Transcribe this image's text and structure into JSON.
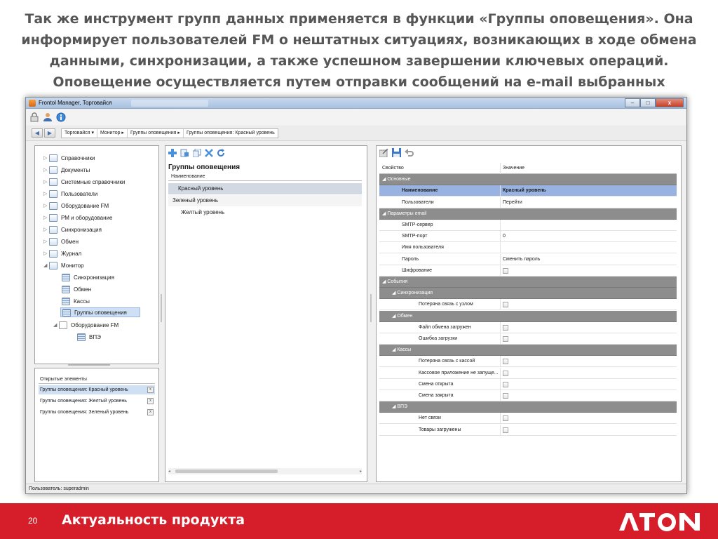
{
  "slide": {
    "heading": "Так же инструмент групп данных применяется в функции «Группы оповещения». Она информирует пользователей FM о нештатных ситуациях, возникающих в ходе обмена данными, синхронизации, а также успешном завершении ключевых операций. Оповещение осуществляется путем отправки сообщений на e-mail выбранных",
    "page_number": "20",
    "footer_title": "Актуальность продукта",
    "logo_text": "ATON",
    "colors": {
      "footer_red": "#d61e2a",
      "heading_gray": "#565656"
    }
  },
  "window": {
    "title": "Frontol Manager, Торговайся",
    "buttons": {
      "minimize": "–",
      "maximize": "□",
      "close": "x"
    },
    "toolbar_icons": [
      "lock-icon",
      "user-icon",
      "info-icon"
    ],
    "status": "Пользователь: superadmin"
  },
  "breadcrumb": {
    "items": [
      "Торговайся ▾",
      "Монитор ▸",
      "Группы оповещения ▸",
      "Группы оповещения: Красный уровень"
    ]
  },
  "tree": {
    "items": [
      {
        "label": "Справочники",
        "arrow": "▷"
      },
      {
        "label": "Документы",
        "arrow": "▷"
      },
      {
        "label": "Системные справочники",
        "arrow": "▷"
      },
      {
        "label": "Пользователи",
        "arrow": "▷"
      },
      {
        "label": "Оборудование FM",
        "arrow": "▷"
      },
      {
        "label": "РМ и оборудование",
        "arrow": "▷"
      },
      {
        "label": "Синхронизация",
        "arrow": "▷"
      },
      {
        "label": "Обмен",
        "arrow": "▷"
      },
      {
        "label": "Журнал",
        "arrow": "▷"
      },
      {
        "label": "Монитор",
        "arrow": "◢"
      },
      {
        "label": "Синхронизация",
        "arrow": ""
      },
      {
        "label": "Обмен",
        "arrow": ""
      },
      {
        "label": "Кассы",
        "arrow": ""
      },
      {
        "label": "Группы оповещения",
        "arrow": ""
      },
      {
        "label": "Оборудование FM",
        "arrow": "◢"
      },
      {
        "label": "ВПЭ",
        "arrow": ""
      }
    ]
  },
  "open_items": {
    "header": "Открытые элементы",
    "rows": [
      "Группы оповещения: Красный уровень",
      "Группы оповещения: Желтый уровень",
      "Группы оповещения: Зеленый уровень"
    ]
  },
  "groups": {
    "title": "Группы оповещения",
    "column": "Наименование",
    "rows": [
      "Красный уровень",
      "Зеленый уровень",
      "Желтый уровень"
    ]
  },
  "properties": {
    "col_property": "Свойство",
    "col_value": "Значение",
    "rows": [
      {
        "kind": "cat",
        "label": "Основные"
      },
      {
        "kind": "sel",
        "label": "Наименование",
        "value": "Красный уровень"
      },
      {
        "kind": "prop",
        "label": "Пользователи",
        "value": "Перейти"
      },
      {
        "kind": "cat",
        "label": "Параметры email"
      },
      {
        "kind": "prop",
        "label": "SMTP-сервер",
        "value": ""
      },
      {
        "kind": "prop",
        "label": "SMTP-порт",
        "value": "0"
      },
      {
        "kind": "prop",
        "label": "Имя пользователя",
        "value": ""
      },
      {
        "kind": "prop",
        "label": "Пароль",
        "value": "Сменить пароль"
      },
      {
        "kind": "check",
        "label": "Шифрование"
      },
      {
        "kind": "cat",
        "label": "События"
      },
      {
        "kind": "cat2",
        "label": "Синхронизация"
      },
      {
        "kind": "check2",
        "label": "Потеряна связь с узлом"
      },
      {
        "kind": "cat2",
        "label": "Обмен"
      },
      {
        "kind": "check2",
        "label": "Файл обмена загружен"
      },
      {
        "kind": "check2",
        "label": "Ошибка загрузки"
      },
      {
        "kind": "cat2",
        "label": "Кассы"
      },
      {
        "kind": "check2",
        "label": "Потеряна связь с кассой"
      },
      {
        "kind": "check2",
        "label": "Кассовое приложение не запуще..."
      },
      {
        "kind": "check2",
        "label": "Смена открыта"
      },
      {
        "kind": "check2",
        "label": "Смена закрыта"
      },
      {
        "kind": "cat2",
        "label": "ВПЭ"
      },
      {
        "kind": "check2",
        "label": "Нет связи"
      },
      {
        "kind": "check2",
        "label": "Товары загружены"
      }
    ]
  }
}
